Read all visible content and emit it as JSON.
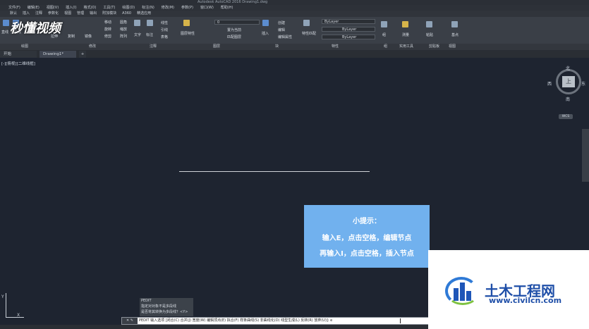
{
  "window": {
    "title": "Autodesk AutoCAD 2016    Drawing1.dwg"
  },
  "menubar": [
    "文件(F)",
    "编辑(E)",
    "视图(V)",
    "插入(I)",
    "格式(O)",
    "工具(T)",
    "绘图(D)",
    "标注(N)",
    "修改(M)",
    "参数(P)",
    "窗口(W)",
    "帮助(H)"
  ],
  "ribbon_tabs": [
    "默认",
    "插入",
    "注释",
    "参数化",
    "视图",
    "管理",
    "输出",
    "附加模块",
    "A360",
    "精选应用"
  ],
  "ribbon": {
    "tools": [
      "直线",
      "多段线",
      "文字",
      "标注",
      "图层特性",
      "插入",
      "特性匹配",
      "组",
      "测量",
      "粘贴",
      "基点"
    ],
    "layer_value": "0",
    "bylayer_1": "ByLayer",
    "bylayer_2": "ByLayer",
    "bylayer_3": "ByLayer",
    "modify_items": [
      "移动",
      "旋转",
      "修剪",
      "复制",
      "镜像",
      "圆角",
      "拉伸",
      "缩放",
      "阵列"
    ],
    "annot_items": [
      "线性",
      "引线",
      "表格"
    ],
    "layer_items": [
      "置为当前",
      "匹配图层"
    ],
    "block_items": [
      "创建",
      "编辑",
      "编辑属性"
    ]
  },
  "panel_labels": [
    "绘图",
    "修改",
    "注释",
    "图层",
    "块",
    "特性",
    "组",
    "实用工具",
    "剪贴板",
    "视图"
  ],
  "doc_tabs": {
    "start": "开始",
    "active": "Drawing1*",
    "plus": "+"
  },
  "viewport_label": "[-][俯视][二维线框]",
  "viewcube": {
    "north": "北",
    "south": "南",
    "east": "东",
    "west": "西",
    "face": "上",
    "wcs": "WCS"
  },
  "tip": {
    "title": "小提示：",
    "line1": "输入E，点击空格，编辑节点",
    "line2": "再输入I，点击空格，插入节点"
  },
  "ucs": {
    "x": "X",
    "y": "Y"
  },
  "command_history": [
    "PEDIT",
    "指定对对象不是多段线",
    "是否将其转换为多段线？<Y>"
  ],
  "command_line": {
    "buttons": "✕ ✎",
    "text": "PEDIT 输入选项 [闭合(C) 合并(J) 宽度(W) 编辑顶点(E) 拟合(F) 样条曲线(S) 非曲线化(D) 线型生成(L) 反转(R) 放弃(U)]: e"
  },
  "watermark": "秒懂视频",
  "logo": {
    "name": "土木工程网",
    "url": "www.civilcn.com"
  }
}
